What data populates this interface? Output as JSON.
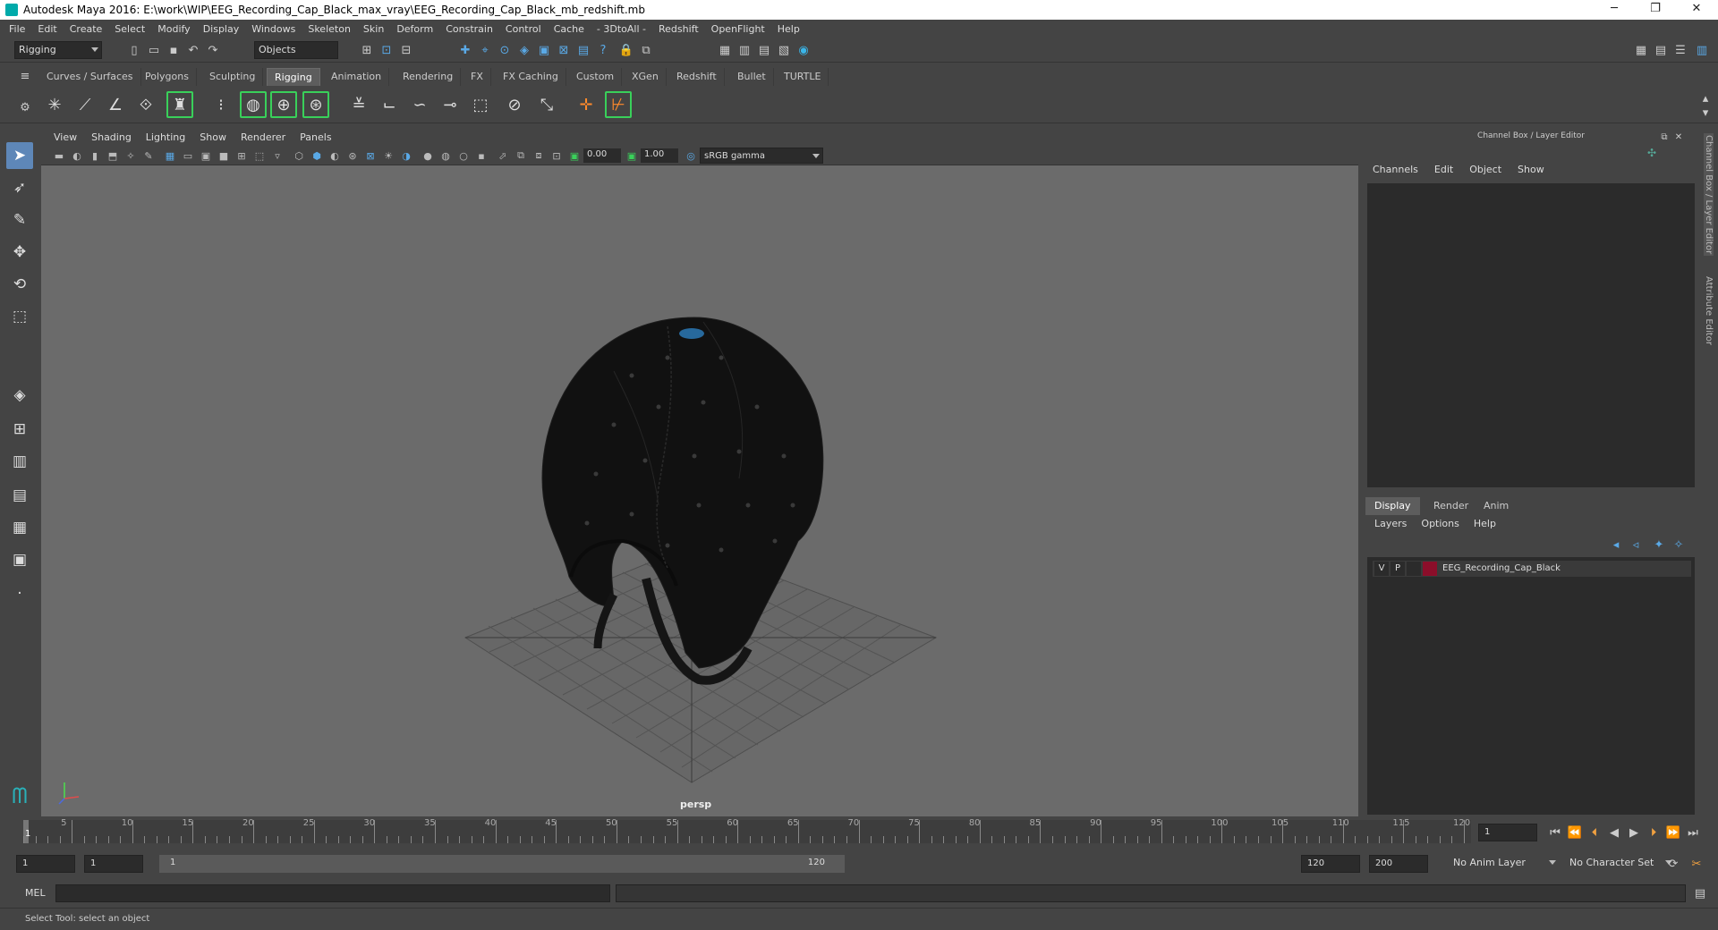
{
  "window": {
    "title": "Autodesk Maya 2016: E:\\work\\WIP\\EEG_Recording_Cap_Black_max_vray\\EEG_Recording_Cap_Black_mb_redshift.mb",
    "minimize": "─",
    "restore": "❐",
    "close": "✕"
  },
  "menubar": [
    "File",
    "Edit",
    "Create",
    "Select",
    "Modify",
    "Display",
    "Windows",
    "Skeleton",
    "Skin",
    "Deform",
    "Constrain",
    "Control",
    "Cache",
    "- 3DtoAll -",
    "Redshift",
    "OpenFlight",
    "Help"
  ],
  "statusline": {
    "menuset": "Rigging",
    "selection_mode": "Objects"
  },
  "shelf": {
    "tabs": [
      "Curves / Surfaces",
      "Polygons",
      "Sculpting",
      "Rigging",
      "Animation",
      "Rendering",
      "FX",
      "FX Caching",
      "Custom",
      "XGen",
      "Redshift",
      "Bullet",
      "TURTLE"
    ],
    "active_tab": "Rigging"
  },
  "viewport": {
    "menu": [
      "View",
      "Shading",
      "Lighting",
      "Show",
      "Renderer",
      "Panels"
    ],
    "exposure": "0.00",
    "gamma": "1.00",
    "color_space": "sRGB gamma",
    "camera": "persp"
  },
  "channel_box": {
    "title": "Channel Box / Layer Editor",
    "menu": [
      "Channels",
      "Edit",
      "Object",
      "Show"
    ]
  },
  "layer_editor": {
    "tabs": [
      "Display",
      "Render",
      "Anim"
    ],
    "active_tab": "Display",
    "menu": [
      "Layers",
      "Options",
      "Help"
    ],
    "layers": [
      {
        "v": "V",
        "p": "P",
        "color": "#8b0e2a",
        "name": "EEG_Recording_Cap_Black"
      }
    ]
  },
  "side_tabs": [
    "Channel Box / Layer Editor",
    "Attribute Editor"
  ],
  "timeline": {
    "labels": [
      "5",
      "10",
      "15",
      "20",
      "25",
      "30",
      "35",
      "40",
      "45",
      "50",
      "55",
      "60",
      "65",
      "70",
      "75",
      "80",
      "85",
      "90",
      "95",
      "100",
      "105",
      "110",
      "115",
      "120"
    ],
    "current_frame_label": "1",
    "current_frame_field": "1"
  },
  "range": {
    "start": "1",
    "playback_start": "1",
    "slider_start": "1",
    "slider_end": "120",
    "playback_end": "120",
    "end": "200",
    "anim_layer": "No Anim Layer",
    "character_set": "No Character Set"
  },
  "command": {
    "mel_label": "MEL"
  },
  "help_line": "Select Tool: select an object"
}
